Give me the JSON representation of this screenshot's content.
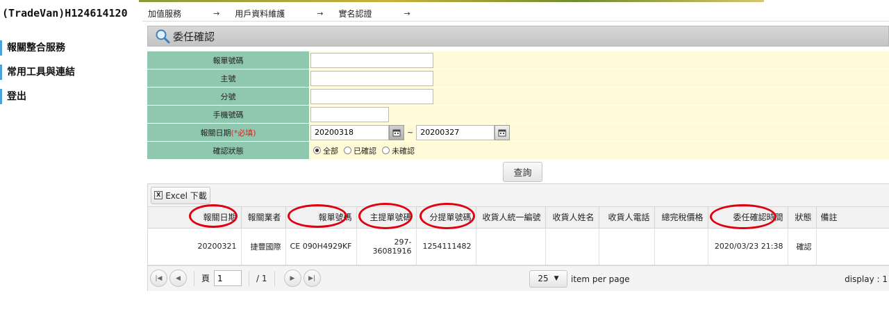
{
  "user": {
    "id": "(TradeVan)H124614120"
  },
  "breadcrumb": [
    "加值服務",
    "用戶資料維護",
    "實名認證"
  ],
  "sidebar": {
    "items": [
      {
        "label": "報關整合服務"
      },
      {
        "label": "常用工具與連結"
      },
      {
        "label": "登出"
      }
    ]
  },
  "panel": {
    "title": "委任確認",
    "icon": "magnifier-icon"
  },
  "form": {
    "fields": {
      "declaration_no": {
        "label": "報單號碼",
        "value": ""
      },
      "master_no": {
        "label": "主號",
        "value": ""
      },
      "house_no": {
        "label": "分號",
        "value": ""
      },
      "mobile": {
        "label": "手機號碼",
        "value": ""
      },
      "date": {
        "label": "報關日期",
        "required": "(*必填)",
        "from": "20200318",
        "to": "20200327",
        "sep": "~"
      },
      "status": {
        "label": "確認狀態",
        "options": [
          "全部",
          "已確認",
          "未確認"
        ],
        "selected": "全部"
      }
    },
    "search_label": "查詢"
  },
  "grid": {
    "excel_label": "Excel 下載",
    "columns": [
      "報關日期",
      "報關業者",
      "報單號碼",
      "主提單號碼",
      "分提單號碼",
      "收貨人統一編號",
      "收貨人姓名",
      "收貨人電話",
      "總完稅價格",
      "委任確認時間",
      "狀態",
      "備註"
    ],
    "rows": [
      [
        "20200321",
        "捷豐國際",
        "CE 090H4929KF",
        "297-36081916",
        "1254111482",
        "",
        "",
        "",
        "",
        "2020/03/23 21:38",
        "確認",
        ""
      ]
    ]
  },
  "pager": {
    "page_label": "頁",
    "current_page": "1",
    "total_pages": "/ 1",
    "per_page": "25",
    "per_page_label": "item per page",
    "display_label": "display : 1"
  },
  "colors": {
    "label_bg": "#8fc8ae",
    "value_bg": "#fffbd8",
    "highlight": "#e00010"
  }
}
